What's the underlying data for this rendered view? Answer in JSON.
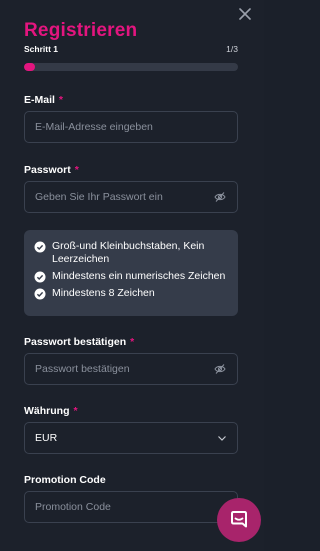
{
  "header": {
    "title": "Registrieren",
    "close_icon": "close-icon"
  },
  "progress": {
    "step_label": "Schritt 1",
    "step_count": "1/3",
    "fraction": 0.05
  },
  "email": {
    "label": "E-Mail",
    "required_mark": "*",
    "placeholder": "E-Mail-Adresse eingeben"
  },
  "password": {
    "label": "Passwort",
    "required_mark": "*",
    "placeholder": "Geben Sie Ihr Passwort ein",
    "toggle_icon": "eye-off-icon"
  },
  "password_rules": [
    {
      "text": "Groß-und Kleinbuchstaben, Kein Leerzeichen"
    },
    {
      "text": "Mindestens ein numerisches Zeichen"
    },
    {
      "text": "Mindestens 8 Zeichen"
    }
  ],
  "confirm_password": {
    "label": "Passwort bestätigen",
    "required_mark": "*",
    "placeholder": "Passwort bestätigen",
    "toggle_icon": "eye-off-icon"
  },
  "currency": {
    "label": "Währung",
    "required_mark": "*",
    "selected": "EUR",
    "icon": "chevron-down-icon"
  },
  "promotion": {
    "label": "Promotion Code",
    "placeholder": "Promotion Code"
  },
  "chat": {
    "icon": "chat-icon"
  },
  "colors": {
    "accent": "#e3157f",
    "background": "#1c212b",
    "rule_box": "#353c4a",
    "chat_button": "#a8246b"
  }
}
